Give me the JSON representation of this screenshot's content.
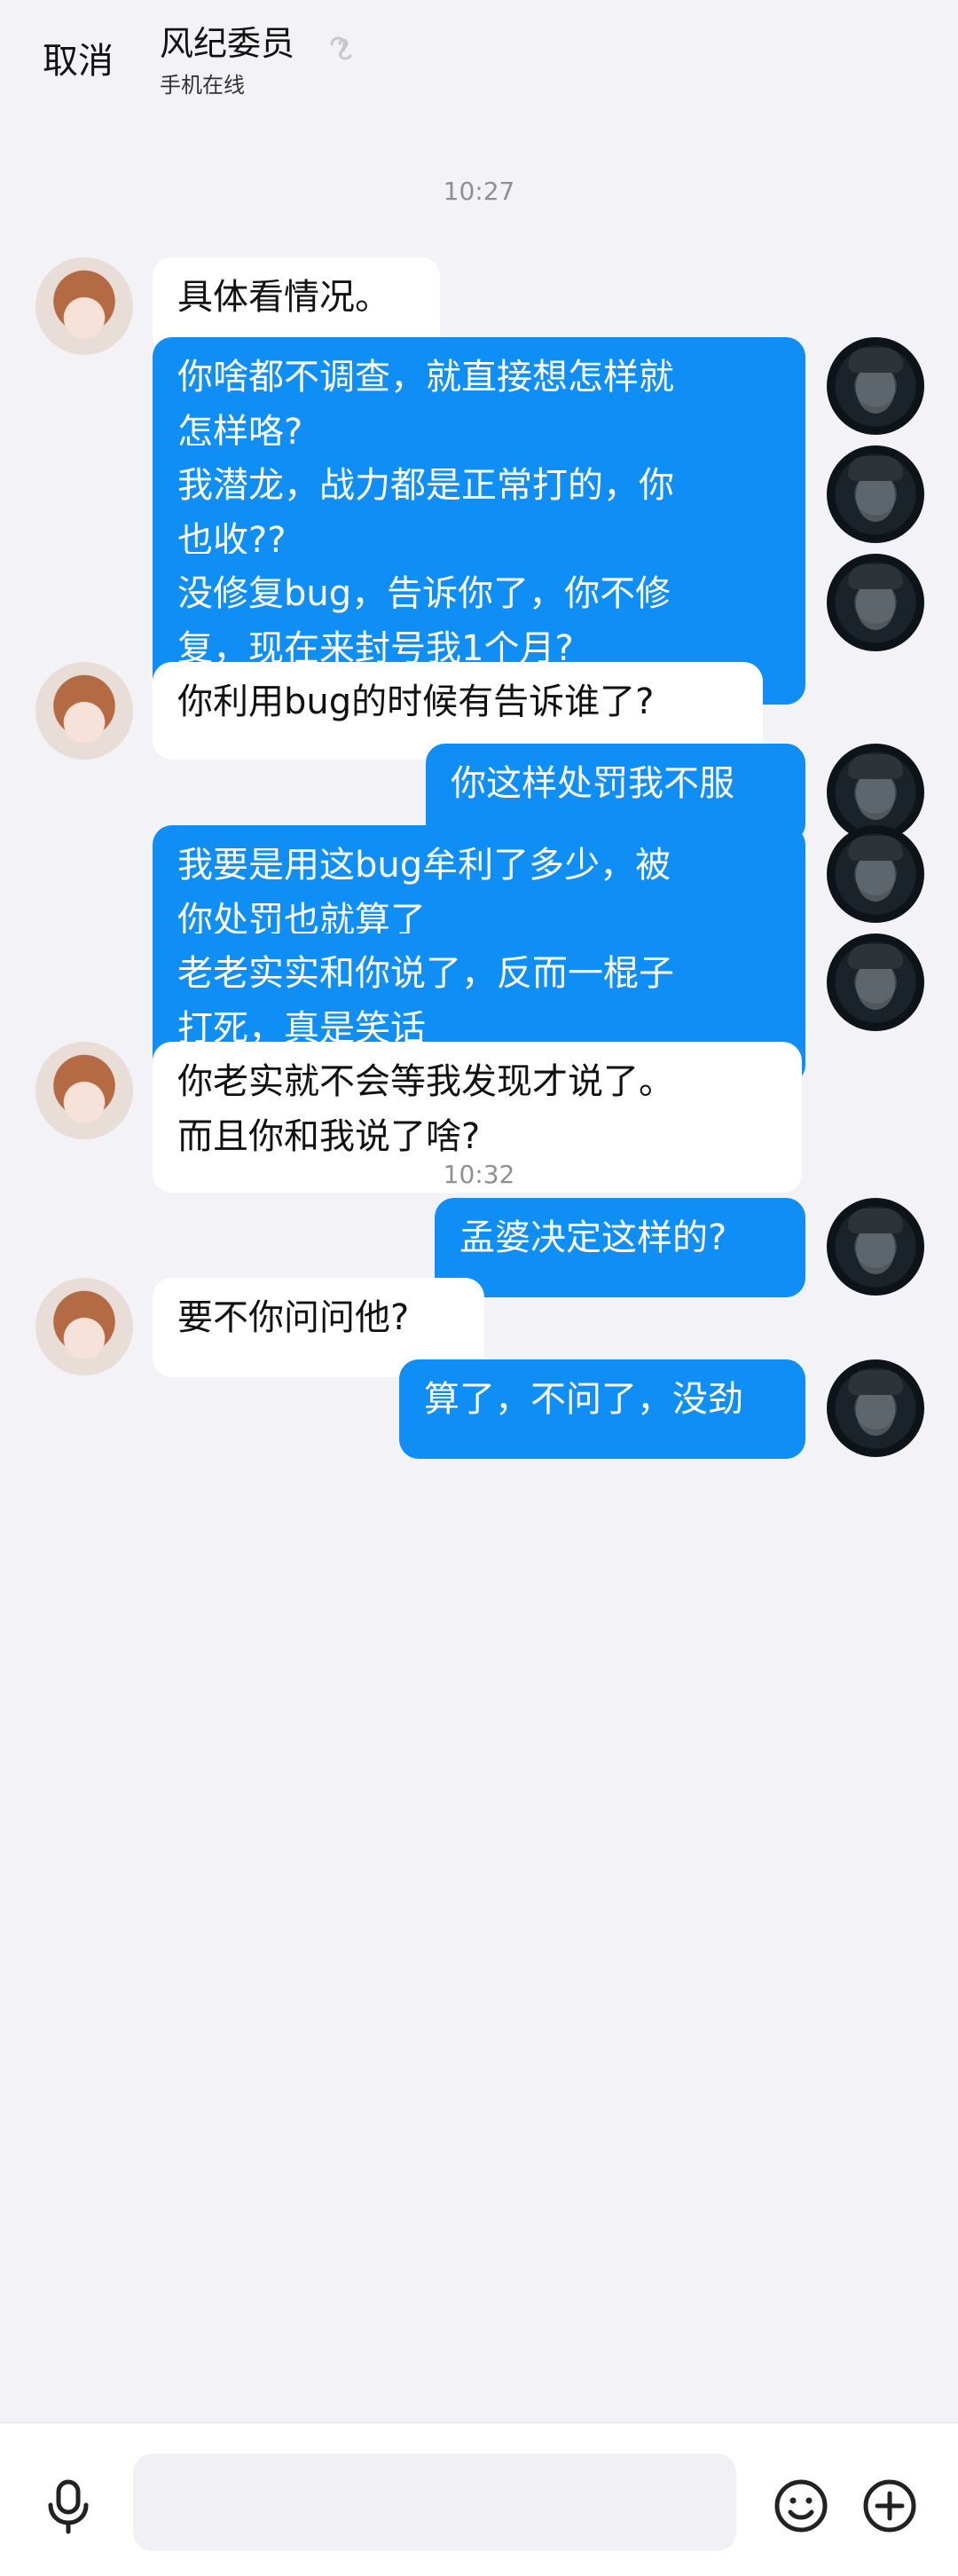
{
  "header": {
    "cancel_label": "取消",
    "title": "风纪委员",
    "status": "手机在线",
    "ear_icon": "ear-icon"
  },
  "messages": {
    "timestamp_1": "10:27",
    "m1": "具体看情况。",
    "m2": "你啥都不调查，就直接想怎样就\n怎样咯?",
    "m3": "我潜龙，战力都是正常打的，你\n也收??",
    "m4": "没修复bug，告诉你了，你不修\n复，现在来封号我1个月?",
    "m5": "你利用bug的时候有告诉谁了?",
    "m6": "你这样处罚我不服",
    "m7": "我要是用这bug牟利了多少，被\n你处罚也就算了",
    "m8": "老老实实和你说了，反而一棍子\n打死，真是笑话",
    "m9": "你老实就不会等我发现才说了。\n而且你和我说了啥?",
    "timestamp_2": "10:32",
    "m10": "孟婆决定这样的?",
    "m11": "要不你问问他?",
    "m12": "算了，不问了，没劲"
  },
  "input_bar": {
    "placeholder": "",
    "mic_icon": "microphone-icon",
    "emoji_icon": "emoji-icon",
    "plus_icon": "plus-icon"
  },
  "colors": {
    "background": "#f3f2f7",
    "outgoing_bubble": "#0f8ff5",
    "incoming_bubble": "#ffffff",
    "timestamp": "#8f8f94"
  }
}
